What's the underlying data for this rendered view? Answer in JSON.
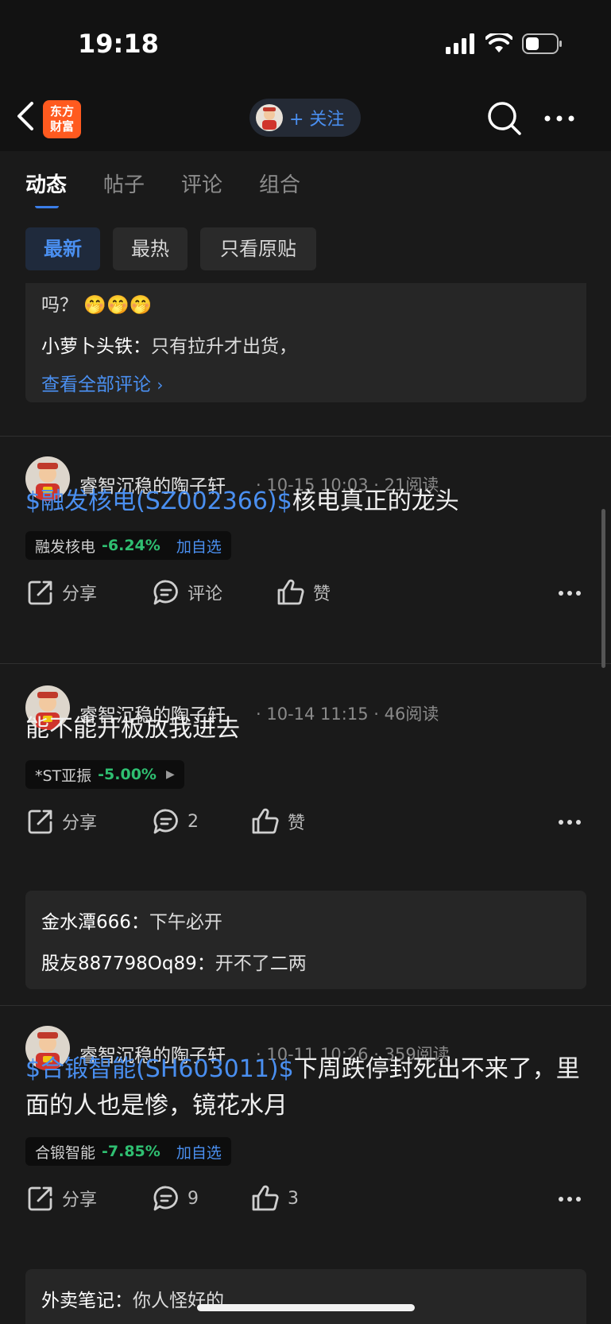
{
  "status": {
    "time": "19:18"
  },
  "nav": {
    "logo_line1": "东方",
    "logo_line2": "财富",
    "follow_label": "+ 关注"
  },
  "tabs": [
    {
      "label": "动态",
      "active": true
    },
    {
      "label": "帖子",
      "active": false
    },
    {
      "label": "评论",
      "active": false
    },
    {
      "label": "组合",
      "active": false
    }
  ],
  "filters": [
    {
      "label": "最新",
      "active": true
    },
    {
      "label": "最热",
      "active": false
    },
    {
      "label": "只看原贴",
      "active": false
    }
  ],
  "top_comments": {
    "partial_line": "吗？",
    "emoji": "🤭🤭🤭",
    "line2_user": "小萝卜头铁：",
    "line2_text": "只有拉升才出货，",
    "view_all": "查看全部评论"
  },
  "posts": [
    {
      "author": "睿智沉稳的陶子轩",
      "time": "10-15 10:03",
      "reads": "21阅读",
      "tag": "$融发核电(SZ002366)$",
      "text": "核电真正的龙头",
      "stock": {
        "name": "融发核电",
        "change": "-6.24%",
        "action": "加自选"
      },
      "share": "分享",
      "comment": "评论",
      "like": "赞",
      "comments": []
    },
    {
      "author": "睿智沉稳的陶子轩",
      "time": "10-14 11:15",
      "reads": "46阅读",
      "tag": "",
      "text": "能不能开板放我进去",
      "stock": {
        "name": "*ST亚振",
        "change": "-5.00%",
        "action": ""
      },
      "share": "分享",
      "comment": "2",
      "like": "赞",
      "comments": [
        {
          "user": "金水潭666：",
          "text": "下午必开"
        },
        {
          "user": "股友887798Oq89：",
          "text": "开不了二两"
        }
      ]
    },
    {
      "author": "睿智沉稳的陶子轩",
      "time": "10-11 10:26",
      "reads": "359阅读",
      "tag": "$合锻智能(SH603011)$",
      "text": "下周跌停封死出不来了，里面的人也是惨，镜花水月",
      "stock": {
        "name": "合锻智能",
        "change": "-7.85%",
        "action": "加自选"
      },
      "share": "分享",
      "comment": "9",
      "like": "3",
      "comments": [
        {
          "user": "外卖笔记：",
          "text": "你人怪好的"
        }
      ]
    }
  ],
  "colors": {
    "accent": "#4a8ff0",
    "down": "#2fbf71",
    "logo": "#ff5a1f",
    "background": "#1a1a1a"
  }
}
